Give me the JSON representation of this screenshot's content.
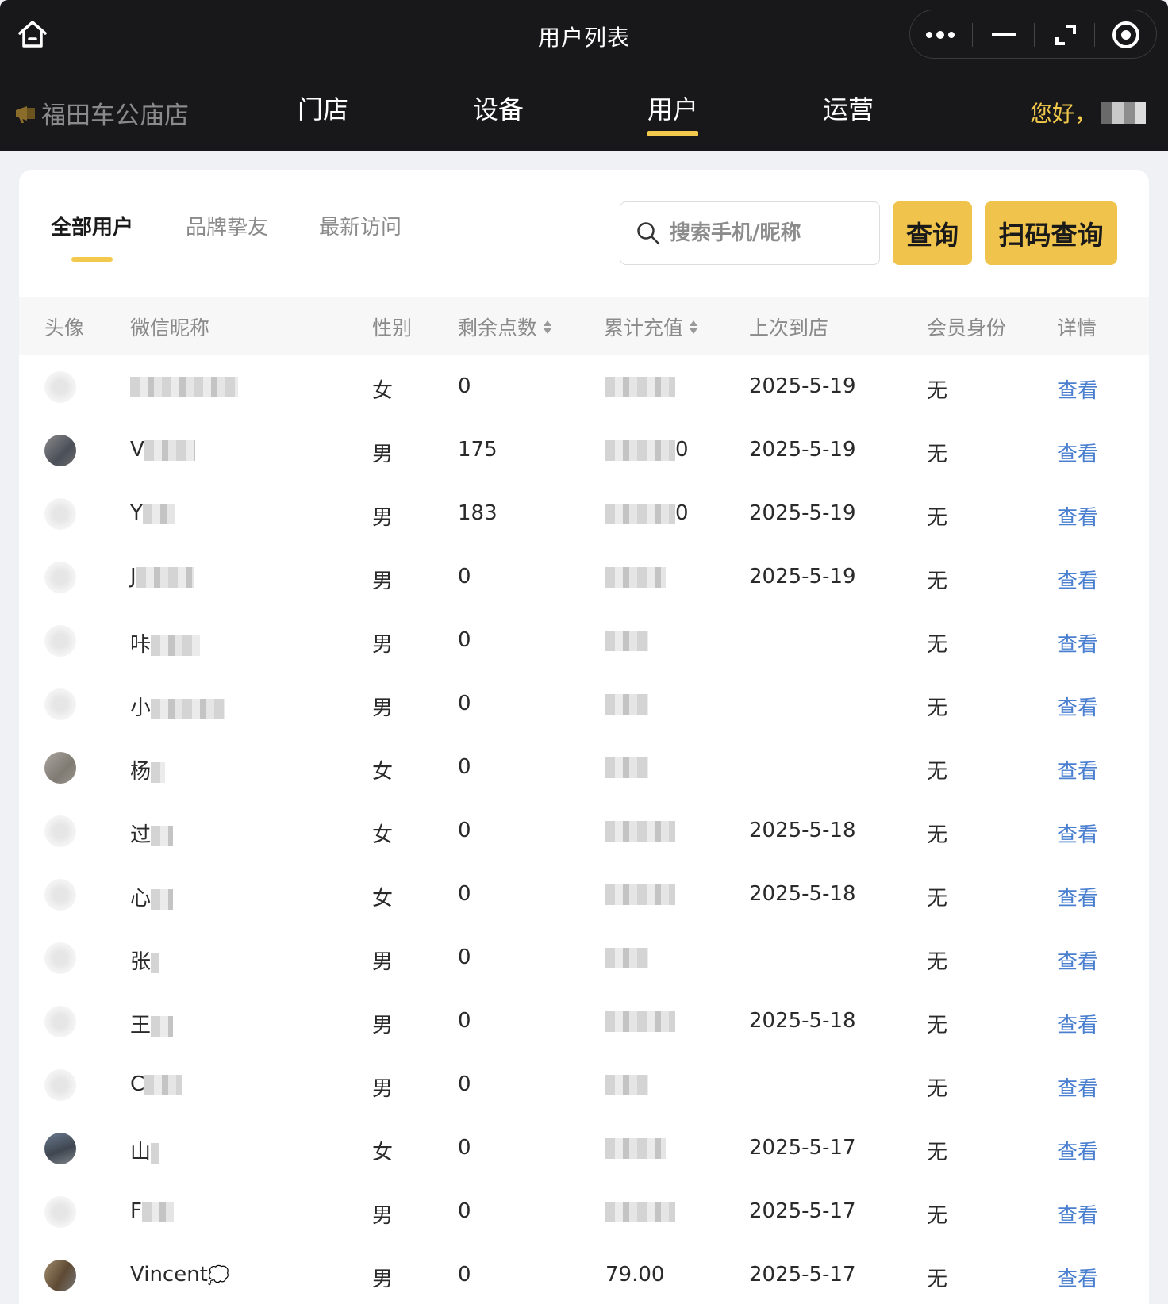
{
  "window": {
    "title": "用户列表",
    "more_icon": "more-dots-icon",
    "minimize_icon": "minimize-icon",
    "restore_icon": "restore-icon",
    "close_icon": "target-close-icon"
  },
  "nav": {
    "store_name": "福田车公庙店",
    "items": [
      {
        "label": "门店",
        "active": false
      },
      {
        "label": "设备",
        "active": false
      },
      {
        "label": "用户",
        "active": true
      },
      {
        "label": "运营",
        "active": false
      }
    ],
    "greeting": "您好，"
  },
  "tabs": [
    {
      "label": "全部用户",
      "active": true
    },
    {
      "label": "品牌挚友",
      "active": false
    },
    {
      "label": "最新访问",
      "active": false
    }
  ],
  "search": {
    "placeholder": "搜索手机/昵称",
    "query_label": "查询",
    "scan_label": "扫码查询"
  },
  "table": {
    "headers": [
      "头像",
      "微信昵称",
      "性别",
      "剩余点数",
      "累计充值",
      "上次到店",
      "会员身份",
      "详情"
    ],
    "rows": [
      {
        "nickname": "",
        "gender": "女",
        "points": "0",
        "recharge": "",
        "last_visit": "2025-5-19",
        "member": "无",
        "detail": "查看"
      },
      {
        "nickname": "V",
        "gender": "男",
        "points": "175",
        "recharge": "0",
        "last_visit": "2025-5-19",
        "member": "无",
        "detail": "查看"
      },
      {
        "nickname": "Y",
        "gender": "男",
        "points": "183",
        "recharge": "0",
        "last_visit": "2025-5-19",
        "member": "无",
        "detail": "查看"
      },
      {
        "nickname": "J",
        "gender": "男",
        "points": "0",
        "recharge": "",
        "last_visit": "2025-5-19",
        "member": "无",
        "detail": "查看"
      },
      {
        "nickname": "咔",
        "gender": "男",
        "points": "0",
        "recharge": "",
        "last_visit": "",
        "member": "无",
        "detail": "查看"
      },
      {
        "nickname": "小",
        "gender": "男",
        "points": "0",
        "recharge": "",
        "last_visit": "",
        "member": "无",
        "detail": "查看"
      },
      {
        "nickname": "杨",
        "gender": "女",
        "points": "0",
        "recharge": "",
        "last_visit": "",
        "member": "无",
        "detail": "查看"
      },
      {
        "nickname": "过",
        "gender": "女",
        "points": "0",
        "recharge": "",
        "last_visit": "2025-5-18",
        "member": "无",
        "detail": "查看"
      },
      {
        "nickname": "心",
        "gender": "女",
        "points": "0",
        "recharge": "",
        "last_visit": "2025-5-18",
        "member": "无",
        "detail": "查看"
      },
      {
        "nickname": "张",
        "gender": "男",
        "points": "0",
        "recharge": "",
        "last_visit": "",
        "member": "无",
        "detail": "查看"
      },
      {
        "nickname": "王",
        "gender": "男",
        "points": "0",
        "recharge": "",
        "last_visit": "2025-5-18",
        "member": "无",
        "detail": "查看"
      },
      {
        "nickname": "C",
        "gender": "男",
        "points": "0",
        "recharge": "",
        "last_visit": "",
        "member": "无",
        "detail": "查看"
      },
      {
        "nickname": "山",
        "gender": "女",
        "points": "0",
        "recharge": "",
        "last_visit": "2025-5-17",
        "member": "无",
        "detail": "查看"
      },
      {
        "nickname": "F",
        "gender": "男",
        "points": "0",
        "recharge": "",
        "last_visit": "2025-5-17",
        "member": "无",
        "detail": "查看"
      },
      {
        "nickname": "Vincent",
        "gender": "男",
        "points": "0",
        "recharge": "79.00",
        "last_visit": "2025-5-17",
        "member": "无",
        "detail": "查看"
      }
    ]
  },
  "colors": {
    "header_bg": "#18181a",
    "accent": "#f2c94c",
    "button": "#f0c44c",
    "link": "#4a7fd0"
  }
}
